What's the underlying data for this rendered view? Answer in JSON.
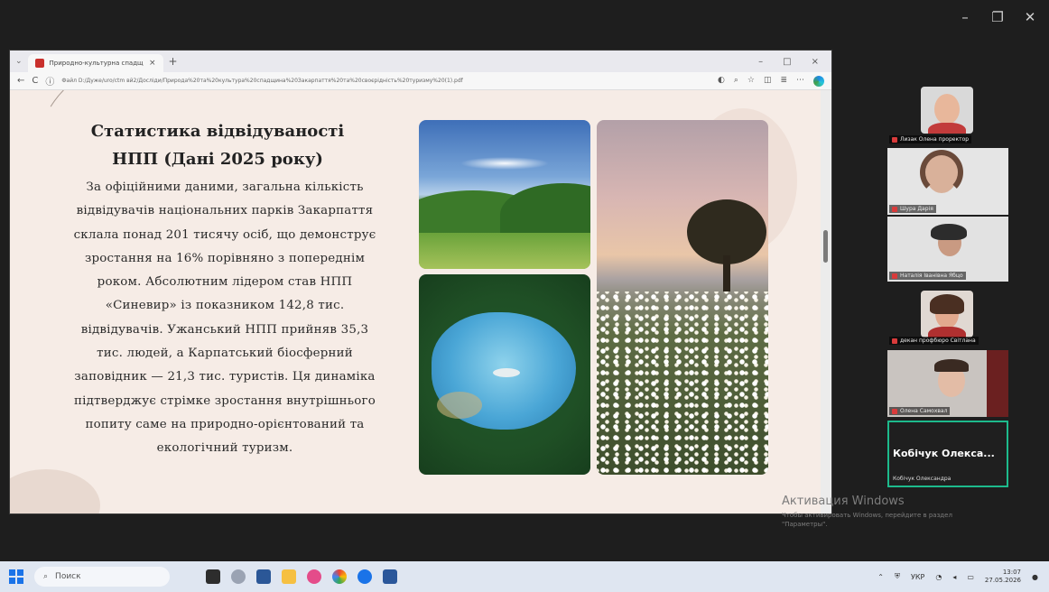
{
  "window_controls": {
    "minimize": "–",
    "restore": "❐",
    "close": "✕"
  },
  "browser": {
    "tab_title": "Природно-культурна спадщ",
    "tab_close": "×",
    "new_tab": "+",
    "controls": {
      "minimize": "–",
      "restore": "□",
      "close": "×"
    },
    "nav": {
      "back": "←",
      "reload": "C"
    },
    "url": "Файл D:/Дуже/uro/ctm вй2/Досліди/Природа%20та%20культура%20спадщина%20Закарпаття%20та%20своєрідність%20туризму%20(1).pdf"
  },
  "slide": {
    "title_lines": [
      "Статистика відвідуваності",
      "НПП (Дані 2025 року)"
    ],
    "body_lines": [
      "За офіційними даними, загальна кількість",
      "відвідувачів національних парків Закарпаття",
      "склала понад 201 тисячу осіб, що демонструє",
      "зростання на 16% порівняно з попереднім",
      "роком. Абсолютним лідером став НПП",
      "«Синевир» із показником 142,8 тис.",
      "відвідувачів. Ужанський НПП прийняв 35,3",
      "тис. людей, а Карпатський біосферний",
      "заповідник — 21,3 тис. туристів. Ця динаміка",
      "підтверджує стрімке зростання внутрішнього",
      "попиту саме на природно-орієнтований та",
      "екологічний туризм."
    ]
  },
  "participants": [
    {
      "name": "Лизак Олена проректор"
    },
    {
      "name": "Шура Дарія"
    },
    {
      "name": "Наталія Іванівна Ябцо"
    },
    {
      "name": "декан профбюро Світлана"
    },
    {
      "name": "Олена Самохвал"
    }
  ],
  "active_speaker": {
    "display": "Кобічук Олекса...",
    "subtitle": "Кобічук Олександра"
  },
  "watermark": {
    "title": "Активация Windows",
    "subtitle_line1": "Чтобы активировать Windows, перейдите в раздел",
    "subtitle_line2": "\"Параметры\"."
  },
  "taskbar": {
    "search_label": "Поиск",
    "lang": "УКР",
    "time": "13:07",
    "date": "27.05.2026",
    "accent": "#1a73e8"
  }
}
